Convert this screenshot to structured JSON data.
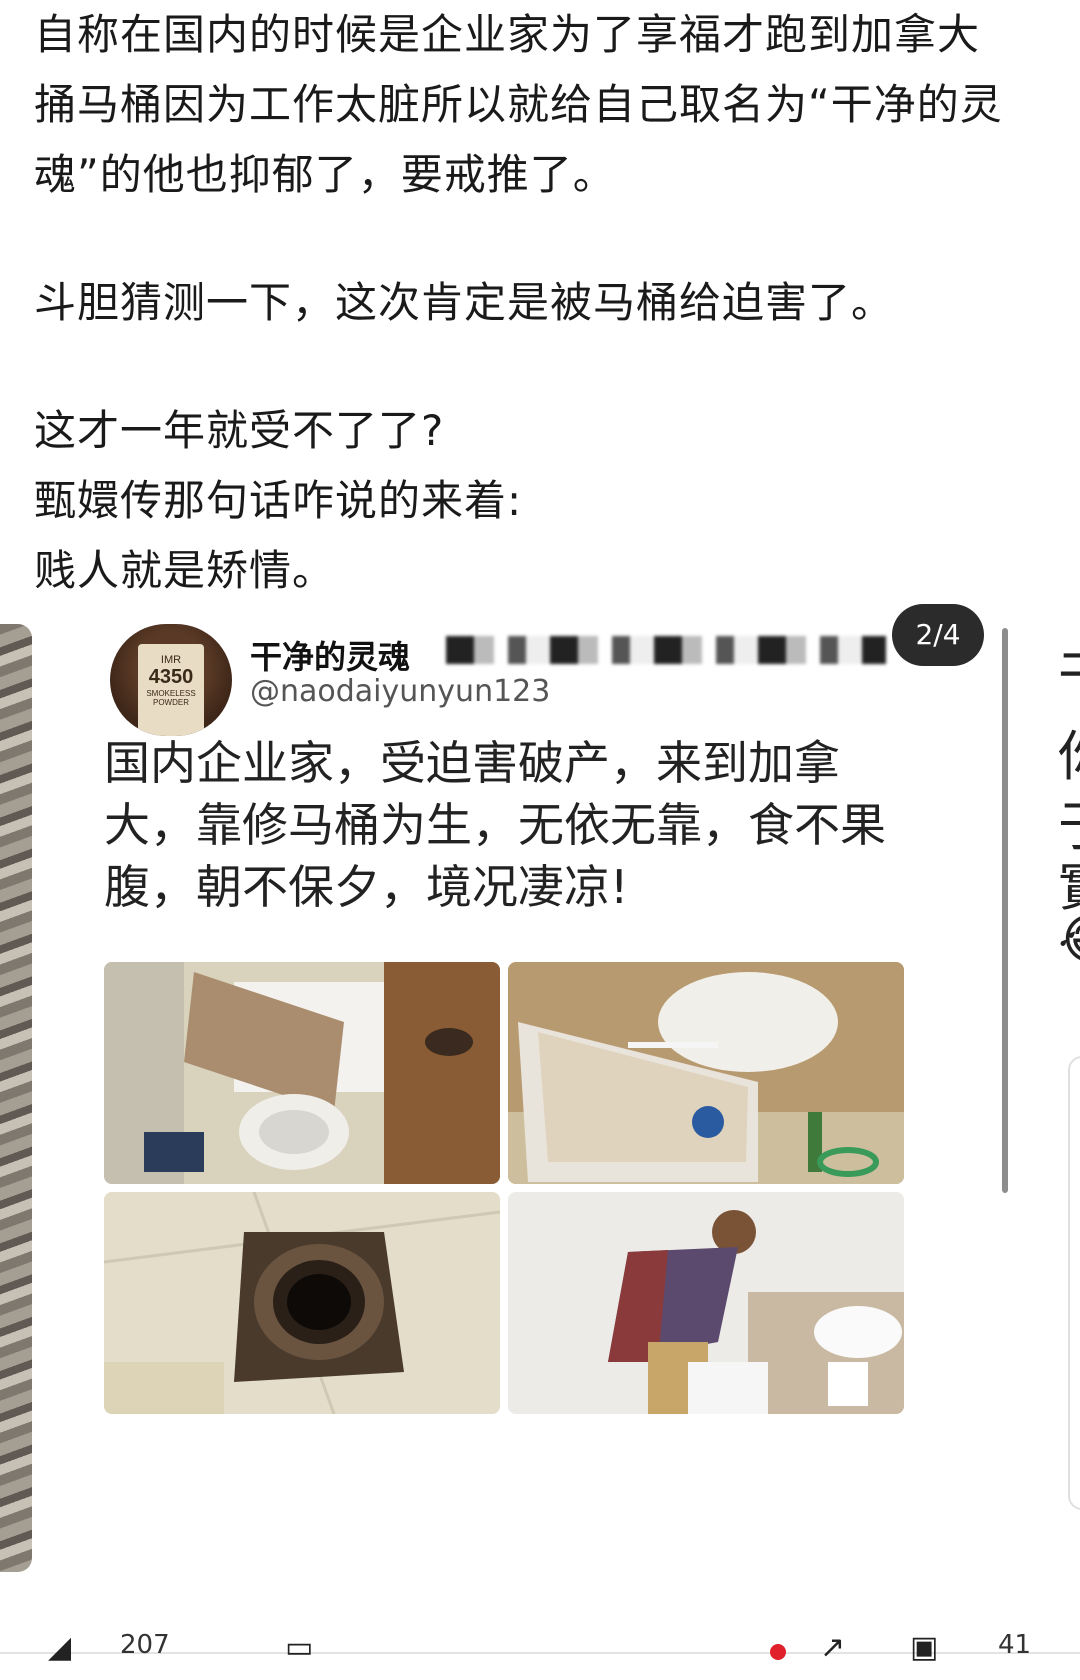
{
  "post": {
    "paragraphs": [
      "自称在国内的时候是企业家为了享福才跑到加拿大",
      "捅马桶因为工作太脏所以就给自己取名为“干净的灵",
      "魂”的他也抑郁了，要戒推了。",
      "",
      "斗胆猜测一下，这次肯定是被马桶给迫害了。",
      "",
      "这才一年就受不了了?",
      "甄嬛传那句话咋说的来着:",
      "贱人就是矫情。"
    ]
  },
  "carousel": {
    "page_indicator": "2/4",
    "right_peek_chars": [
      "干",
      "你",
      "于",
      "實",
      "😂"
    ],
    "embedded_tweet": {
      "avatar_label": {
        "brand": "IMR",
        "number": "4350",
        "text": "SMOKELESS POWDER"
      },
      "author_name": "干净的灵魂",
      "author_handle": "@naodaiyunyun123",
      "text": "国内企业家，受迫害破产，来到加拿大，靠修马桶为生，无依无靠，食不果腹，朝不保夕，境况凄凉!"
    }
  },
  "bottom_bar": {
    "like_count_partial": "207",
    "comment_count_partial": "41"
  },
  "colors": {
    "accent_red": "#e0202a",
    "indicator_bg": "#2b2b2b"
  }
}
